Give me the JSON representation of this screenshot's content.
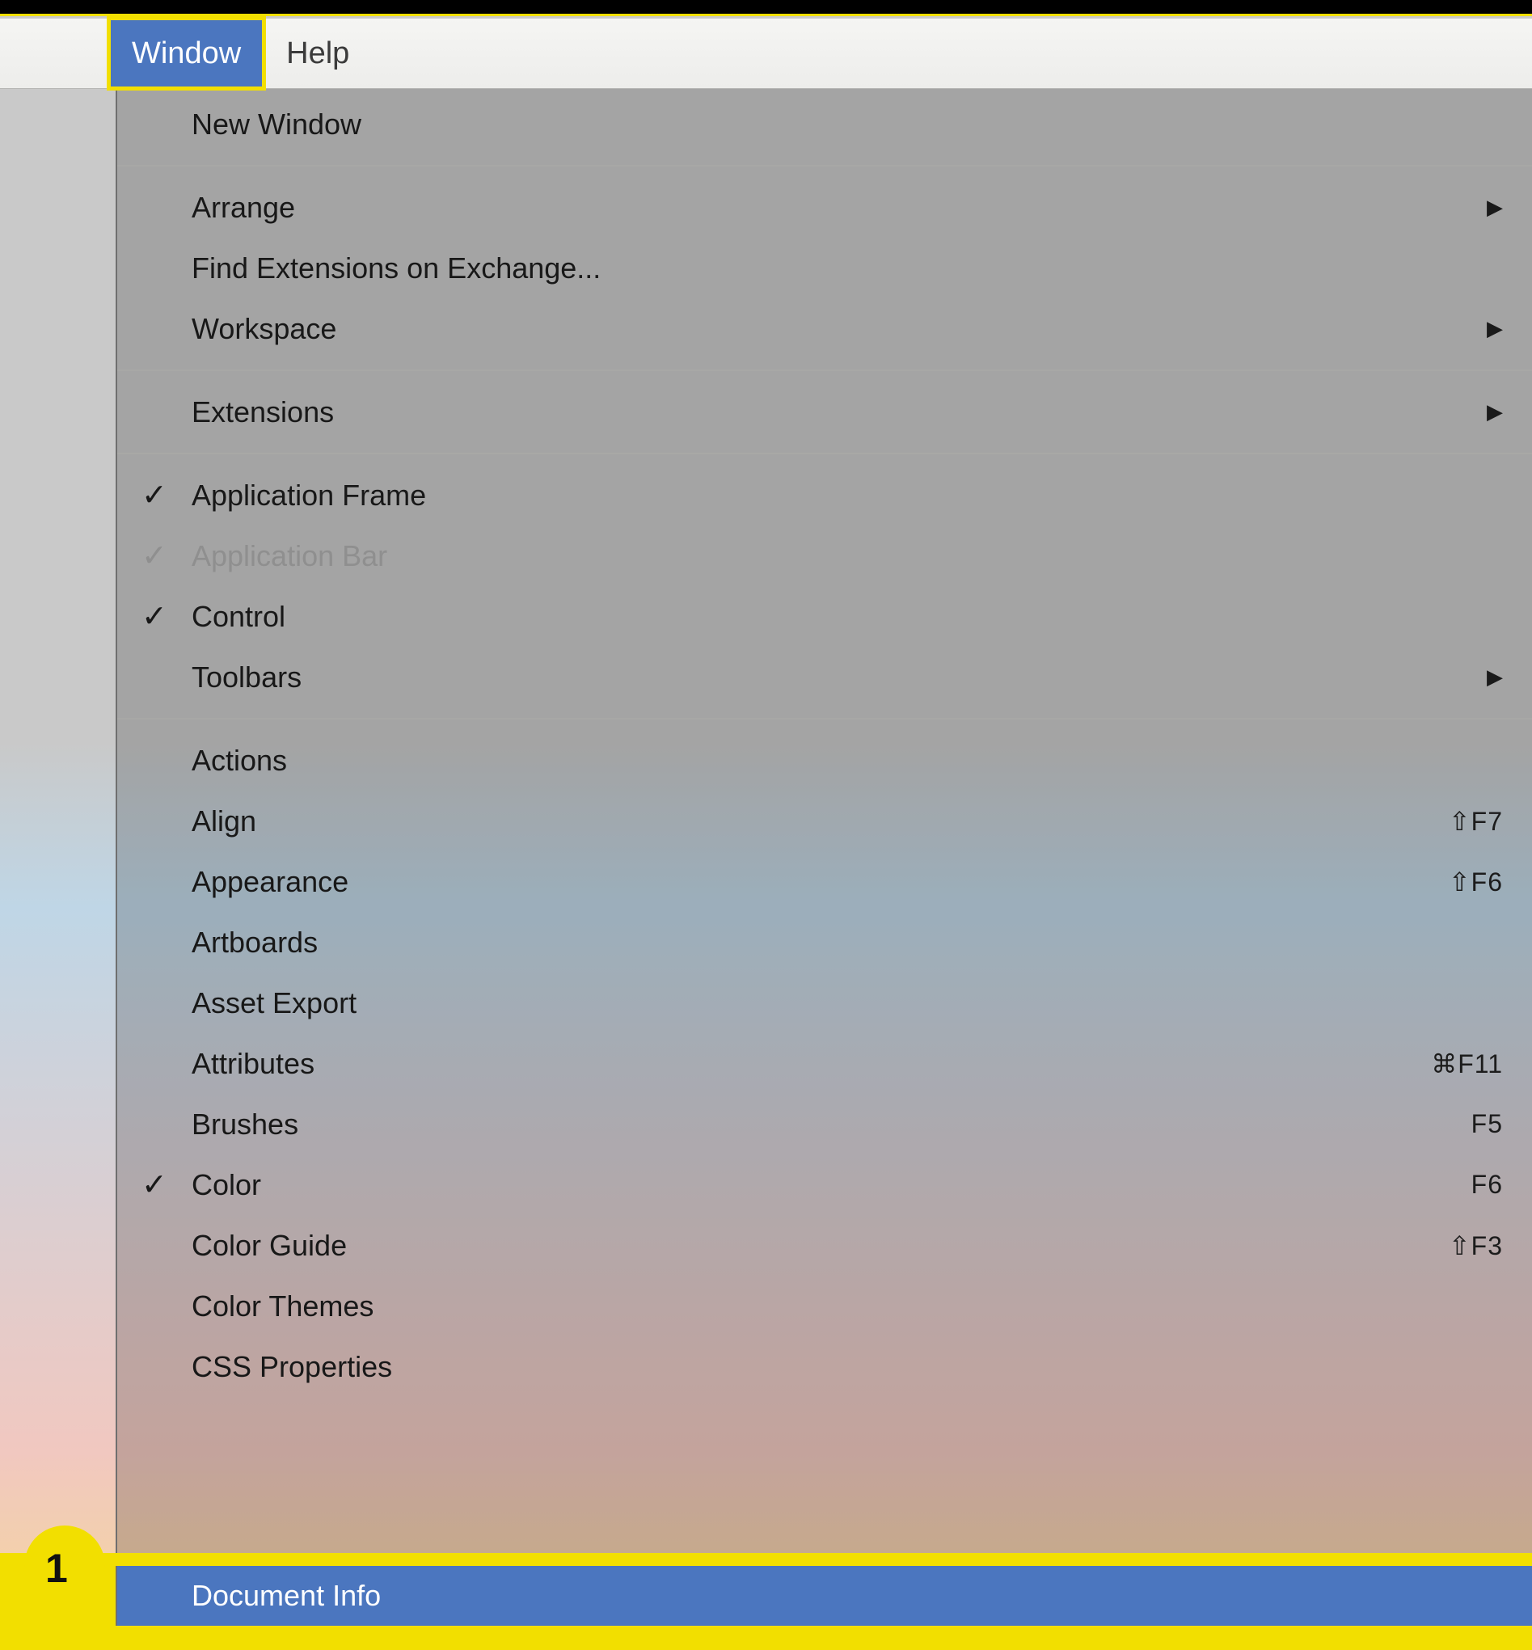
{
  "menubar": {
    "window_label": "Window",
    "help_label": "Help"
  },
  "callout": {
    "number": "1"
  },
  "menu": {
    "new_window": "New Window",
    "arrange": "Arrange",
    "find_ext": "Find Extensions on Exchange...",
    "workspace": "Workspace",
    "extensions": "Extensions",
    "app_frame": "Application Frame",
    "app_bar": "Application Bar",
    "control": "Control",
    "toolbars": "Toolbars",
    "actions": "Actions",
    "align": "Align",
    "appearance": "Appearance",
    "artboards": "Artboards",
    "asset_export": "Asset Export",
    "attributes": "Attributes",
    "brushes": "Brushes",
    "color": "Color",
    "color_guide": "Color Guide",
    "color_themes": "Color Themes",
    "css_props": "CSS Properties",
    "document_info": "Document Info"
  },
  "shortcuts": {
    "align": "⇧F7",
    "appearance": "⇧F6",
    "attributes": "⌘F11",
    "brushes": "F5",
    "color": "F6",
    "color_guide": "⇧F3"
  },
  "icons": {
    "check": "✓",
    "chevron": "▶"
  }
}
